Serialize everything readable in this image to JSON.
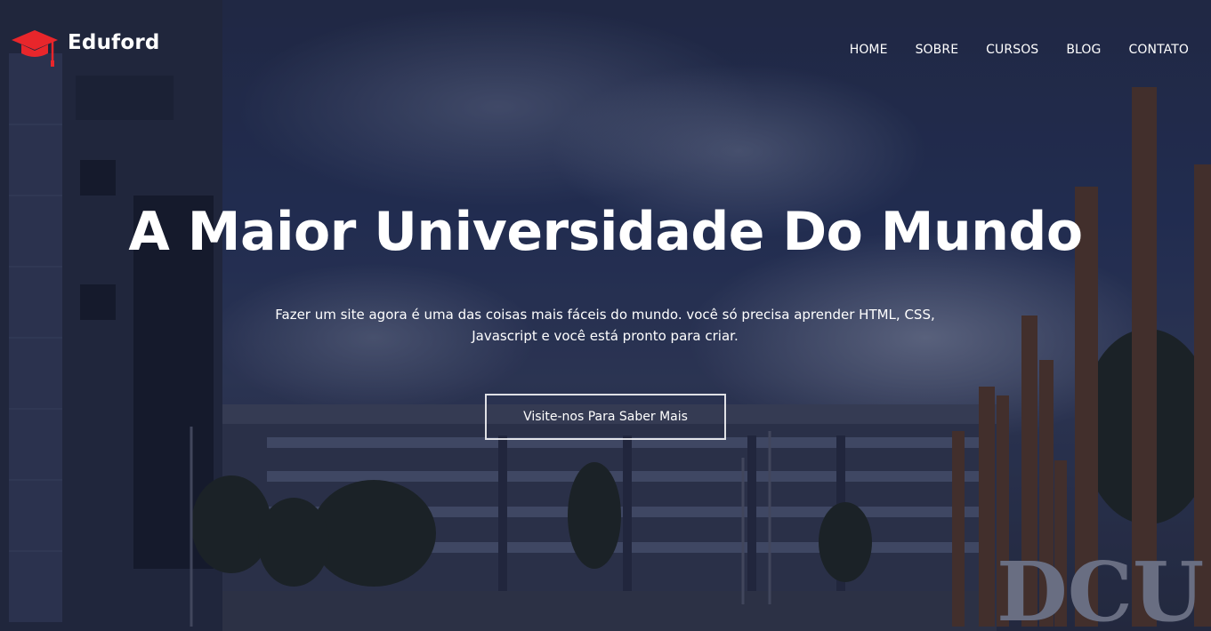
{
  "brand": {
    "name": "Eduford",
    "icon": "graduation-cap-icon",
    "accent": "#e8262b"
  },
  "nav": {
    "items": [
      {
        "label": "HOME"
      },
      {
        "label": "SOBRE"
      },
      {
        "label": "CURSOS"
      },
      {
        "label": "BLOG"
      },
      {
        "label": "CONTATO"
      }
    ]
  },
  "hero": {
    "title": "A Maior Universidade Do Mundo",
    "subtitle_line1": "Fazer um site agora é uma das coisas mais fáceis do mundo. você só precisa aprender HTML, CSS,",
    "subtitle_line2": "Javascript e você está pronto para criar.",
    "cta_label": "Visite-nos Para Saber Mais",
    "sign_text": "DCU"
  }
}
